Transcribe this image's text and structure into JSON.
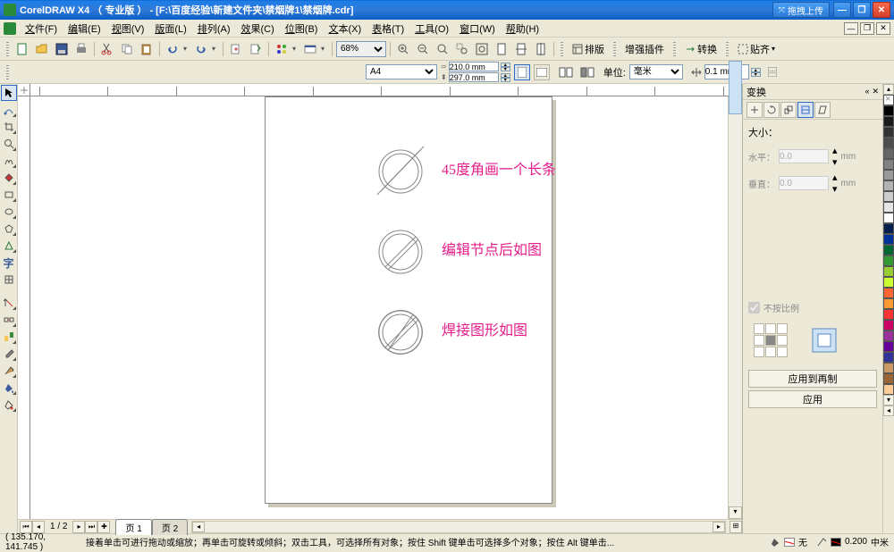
{
  "titlebar": {
    "title": "CorelDRAW X4 （ 专业版 ） - [F:\\百度经验\\新建文件夹\\禁烟牌1\\禁烟牌.cdr]",
    "upload_label": "拖拽上传"
  },
  "menu": {
    "items": [
      "文件(F)",
      "编辑(E)",
      "视图(V)",
      "版面(L)",
      "排列(A)",
      "效果(C)",
      "位图(B)",
      "文本(X)",
      "表格(T)",
      "工具(O)",
      "窗口(W)",
      "帮助(H)"
    ]
  },
  "toolbar1": {
    "zoom": "68%",
    "buttons": {
      "layout": "排版",
      "enhance": "增强插件",
      "transform": "转换",
      "align": "贴齐"
    }
  },
  "propbar": {
    "paper": "A4",
    "width": "210.0 mm",
    "height": "297.0 mm",
    "unit_label": "单位:",
    "unit": "毫米",
    "nudge": "0.1 mm"
  },
  "canvas": {
    "annot1": "45度角画一个长条",
    "annot2": "编辑节点后如图",
    "annot3": "焊接图形如图"
  },
  "page_nav": {
    "label": "1 / 2",
    "tab1": "页 1",
    "tab2": "页 2"
  },
  "status": {
    "coords": "( 135.170, 141.745 )",
    "hint": "接着单击可进行拖动或缩放；再单击可旋转或倾斜；双击工具，可选择所有对象；按住 Shift 键单击可选择多个对象；按住 Alt 键单击...",
    "outline": "0.200",
    "fill_none": "无",
    "fill_unit": "中米"
  },
  "docker": {
    "title": "变换",
    "size_label": "大小：",
    "h_label": "水平：",
    "v_label": "垂直：",
    "h_val": "0.0",
    "v_val": "0.0",
    "unit": "mm",
    "keep_ratio": "不按比例",
    "btn_dup": "应用到再制",
    "btn_apply": "应用"
  },
  "palette": [
    "#000000",
    "#1a1a1a",
    "#333333",
    "#4d4d4d",
    "#666666",
    "#808080",
    "#999999",
    "#b3b3b3",
    "#cccccc",
    "#e6e6e6",
    "#ffffff",
    "#00214d",
    "#003399",
    "#006633",
    "#339933",
    "#99cc33",
    "#ccff33",
    "#ff6633",
    "#ff9933",
    "#ff3333",
    "#cc0066",
    "#993399",
    "#660099",
    "#333399",
    "#cc9966",
    "#996633",
    "#ffcc99"
  ]
}
